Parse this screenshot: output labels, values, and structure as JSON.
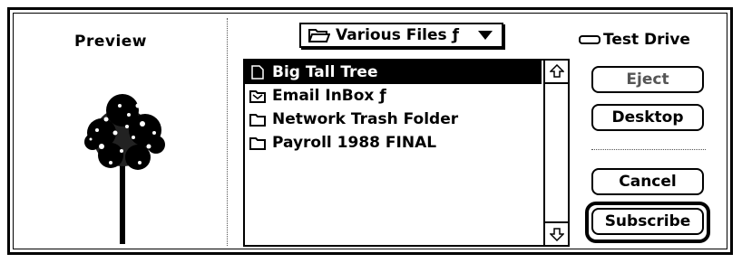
{
  "preview": {
    "title": "Preview"
  },
  "folder_popup": {
    "label": "Various Files ƒ",
    "icon": "folder-icon"
  },
  "file_list": {
    "items": [
      {
        "label": "Big Tall Tree",
        "icon": "picture-icon",
        "selected": true
      },
      {
        "label": "Email InBox ƒ",
        "icon": "mail-folder-icon",
        "selected": false
      },
      {
        "label": "Network Trash Folder",
        "icon": "folder-icon",
        "selected": false
      },
      {
        "label": "Payroll 1988 FINAL",
        "icon": "folder-icon",
        "selected": false
      }
    ]
  },
  "drive": {
    "label": "Test Drive",
    "icon": "disk-icon"
  },
  "buttons": {
    "eject": "Eject",
    "desktop": "Desktop",
    "cancel": "Cancel",
    "subscribe": "Subscribe"
  },
  "colors": {
    "selection": "#000000",
    "background": "#ffffff"
  }
}
